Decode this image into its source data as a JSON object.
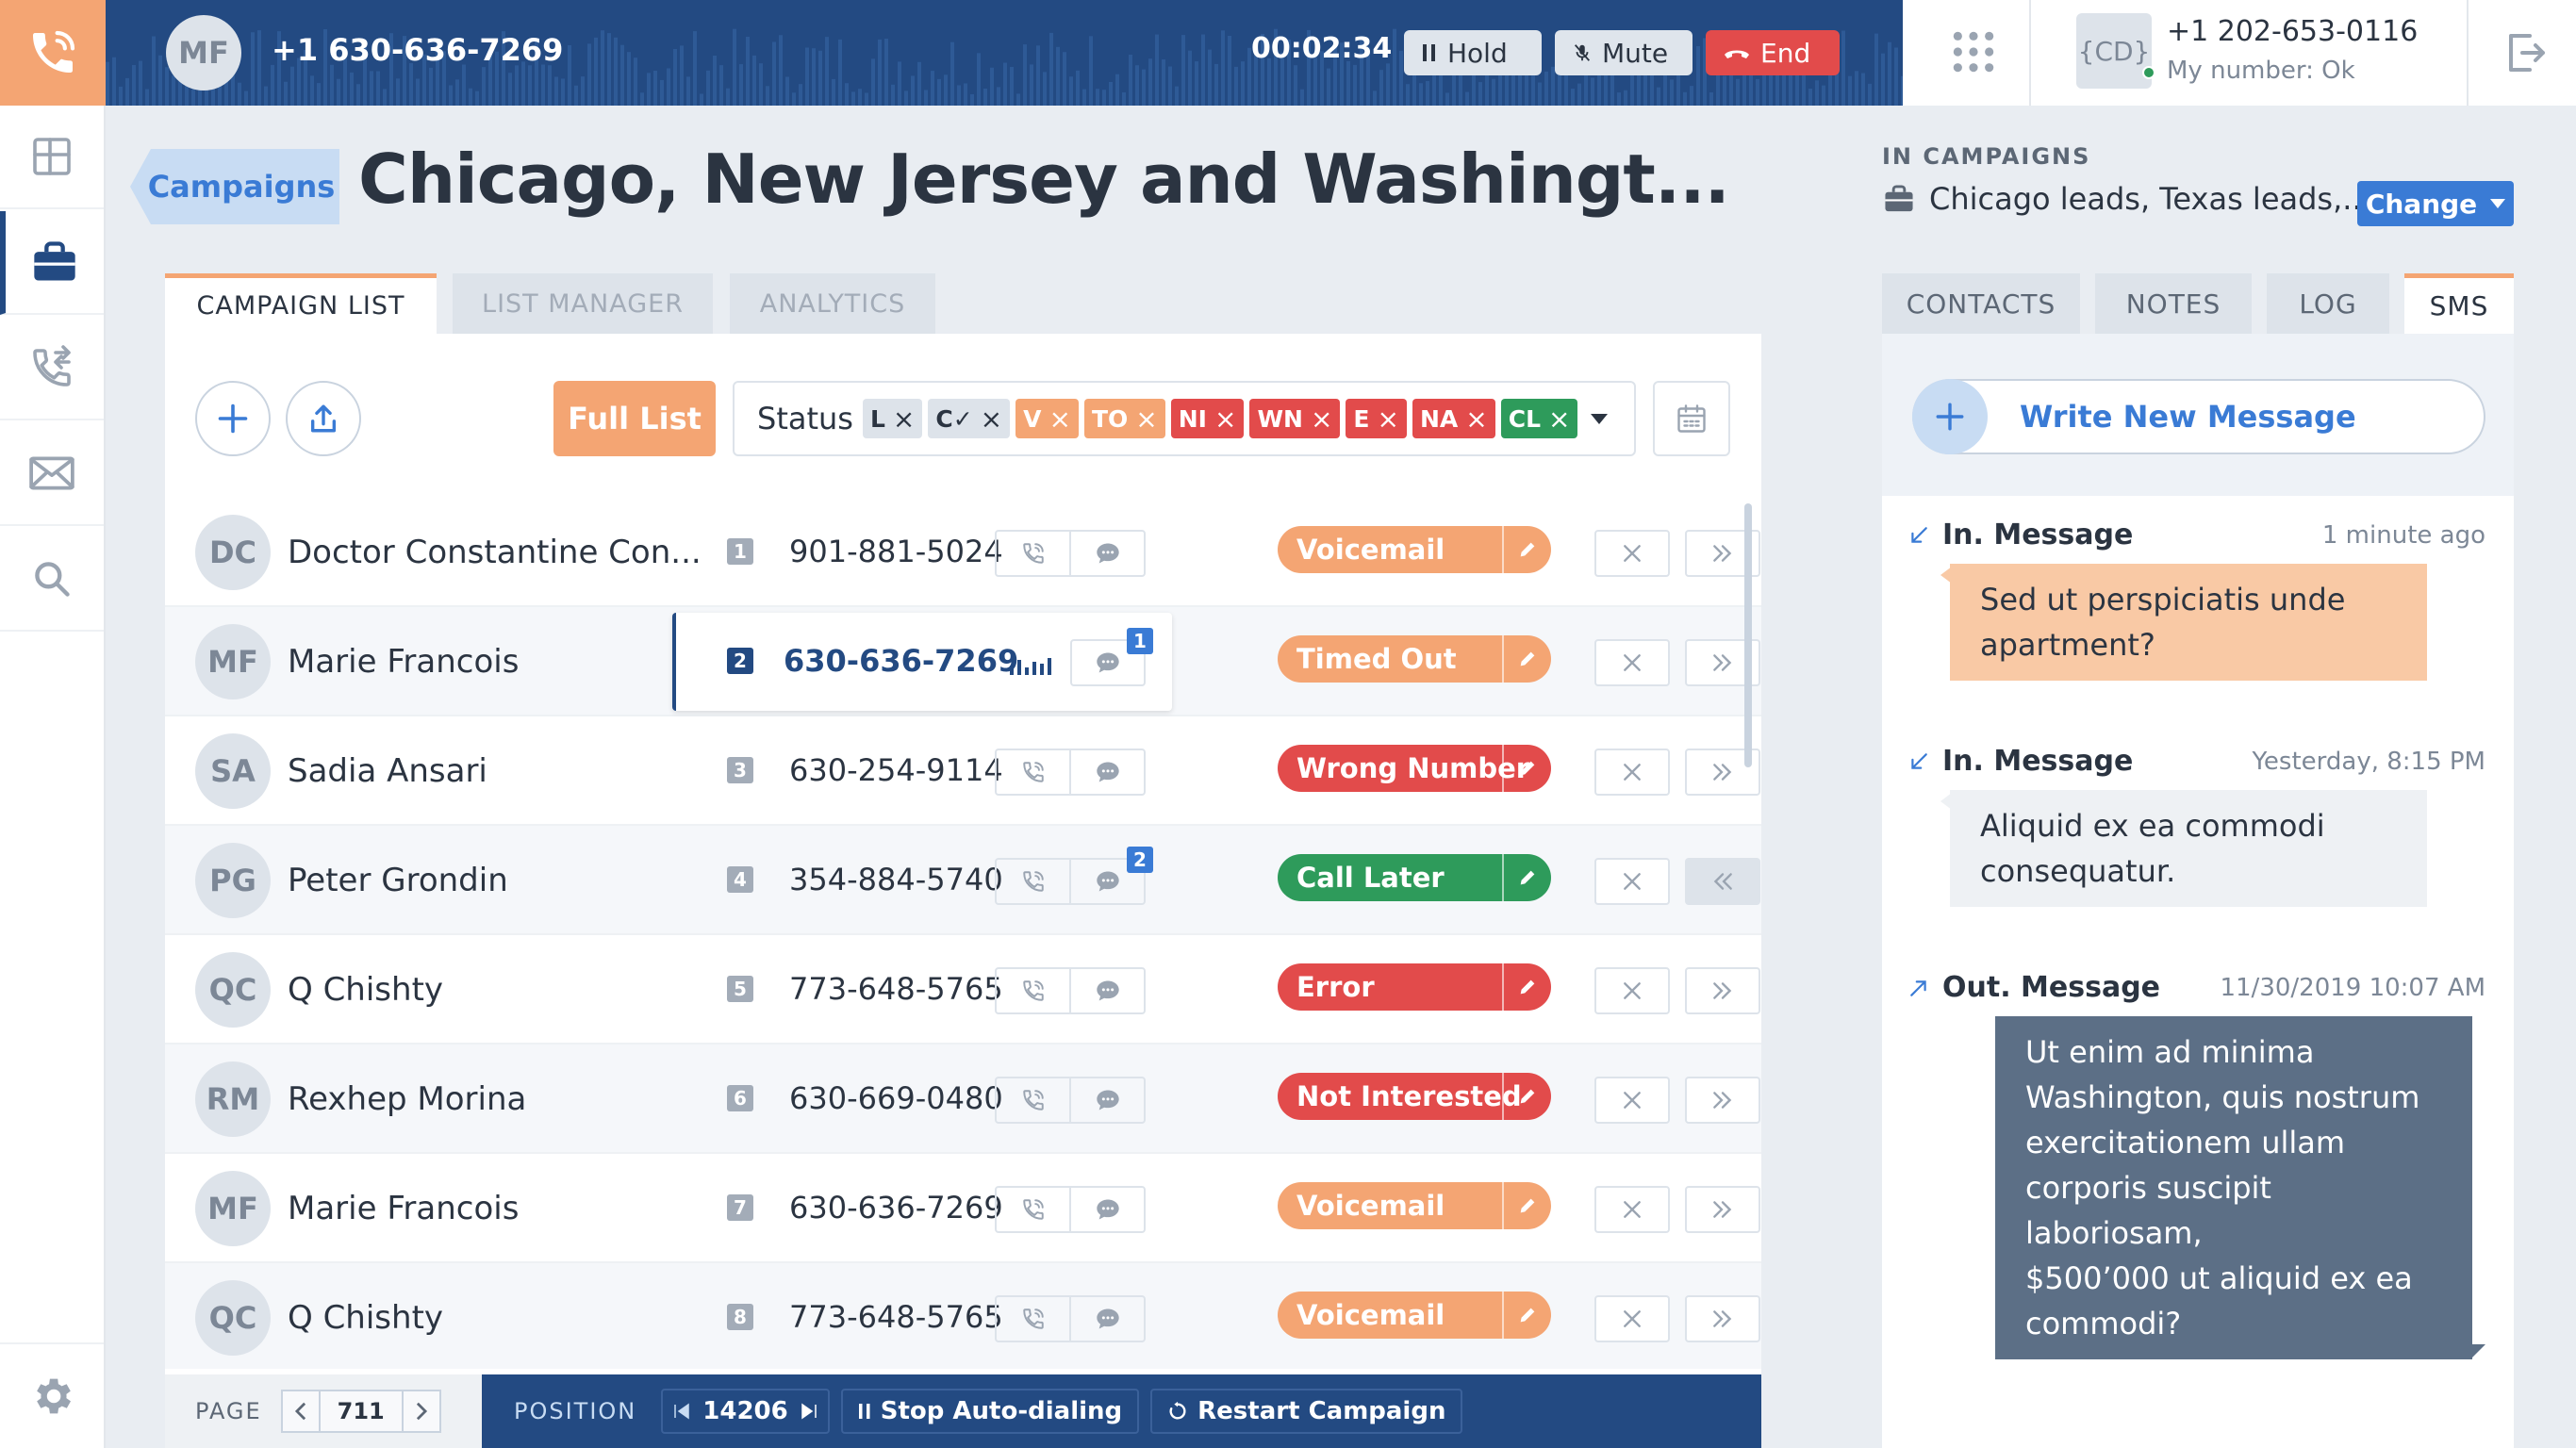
{
  "call": {
    "avatar": "MF",
    "number": "+1 630-636-7269",
    "timer": "00:02:34",
    "hold_label": "Hold",
    "mute_label": "Mute",
    "end_label": "End"
  },
  "header": {
    "avatar": "{CD}",
    "my_number": "+1 202-653-0116",
    "my_number_status": "My number: Ok"
  },
  "breadcrumb": "Campaigns",
  "page_title": "Chicago, New Jersey and Washingt...",
  "tabs": [
    "CAMPAIGN LIST",
    "LIST MANAGER",
    "ANALYTICS"
  ],
  "toolbar": {
    "full_list": "Full List",
    "status_label": "Status",
    "chips": [
      {
        "label": "L",
        "bg": "#dde3ea",
        "fg": "#2b3441"
      },
      {
        "label": "C✓",
        "bg": "#dde3ea",
        "fg": "#2b3441"
      },
      {
        "label": "V",
        "bg": "#f4a573",
        "fg": "#ffffff"
      },
      {
        "label": "TO",
        "bg": "#f4a573",
        "fg": "#ffffff"
      },
      {
        "label": "NI",
        "bg": "#e24b4b",
        "fg": "#ffffff"
      },
      {
        "label": "WN",
        "bg": "#e24b4b",
        "fg": "#ffffff"
      },
      {
        "label": "E",
        "bg": "#e24b4b",
        "fg": "#ffffff"
      },
      {
        "label": "NA",
        "bg": "#e24b4b",
        "fg": "#ffffff"
      },
      {
        "label": "CL",
        "bg": "#2e9b5b",
        "fg": "#ffffff"
      }
    ]
  },
  "contacts": [
    {
      "initials": "DC",
      "name": "Doctor Constantine Con...",
      "index": "1",
      "phone": "901-881-5024",
      "status": "Voicemail",
      "status_color": "#f4a573"
    },
    {
      "initials": "MF",
      "name": "Marie Francois",
      "index": "2",
      "phone": "630-636-7269",
      "status": "Timed Out",
      "status_color": "#f4a573",
      "unread": "1"
    },
    {
      "initials": "SA",
      "name": "Sadia Ansari",
      "index": "3",
      "phone": "630-254-9114",
      "status": "Wrong Number",
      "status_color": "#e24b4b"
    },
    {
      "initials": "PG",
      "name": "Peter Grondin",
      "index": "4",
      "phone": "354-884-5740",
      "status": "Call Later",
      "status_color": "#2e9b5b",
      "unread": "2"
    },
    {
      "initials": "QC",
      "name": "Q Chishty",
      "index": "5",
      "phone": "773-648-5765",
      "status": "Error",
      "status_color": "#e24b4b"
    },
    {
      "initials": "RM",
      "name": "Rexhep Morina",
      "index": "6",
      "phone": "630-669-0480",
      "status": "Not Interested",
      "status_color": "#e24b4b"
    },
    {
      "initials": "MF",
      "name": "Marie Francois",
      "index": "7",
      "phone": "630-636-7269",
      "status": "Voicemail",
      "status_color": "#f4a573"
    },
    {
      "initials": "QC",
      "name": "Q Chishty",
      "index": "8",
      "phone": "773-648-5765",
      "status": "Voicemail",
      "status_color": "#f4a573"
    }
  ],
  "footer": {
    "page_label": "PAGE",
    "page_value": "711",
    "position_label": "POSITION",
    "position_value": "14206",
    "stop_label": "Stop Auto-dialing",
    "restart_label": "Restart Campaign"
  },
  "right": {
    "in_campaigns_label": "IN CAMPAIGNS",
    "campaigns": "Chicago leads, Texas leads,...",
    "change_label": "Change",
    "tabs": [
      "CONTACTS",
      "NOTES",
      "LOG",
      "SMS"
    ],
    "write_label": "Write New Message",
    "messages": [
      {
        "direction": "In. Message",
        "time": "1 minute ago",
        "lines": [
          "Sed ut perspiciatis unde",
          "apartment?"
        ]
      },
      {
        "direction": "In. Message",
        "time": "Yesterday, 8:15 PM",
        "lines": [
          "Aliquid ex ea commodi",
          "consequatur."
        ]
      },
      {
        "direction": "Out. Message",
        "time": "11/30/2019 10:07 AM",
        "lines": [
          "Ut enim ad minima",
          "Washington, quis nostrum",
          "exercitationem ullam",
          "corporis suscipit laboriosam,",
          "$500’000 ut aliquid ex ea",
          "commodi?"
        ]
      }
    ]
  },
  "colors": {
    "navy": "#234a82",
    "accent_orange": "#f4a573",
    "link_blue": "#3a7bd5",
    "danger": "#e24b4b",
    "success": "#2e9b5b"
  }
}
